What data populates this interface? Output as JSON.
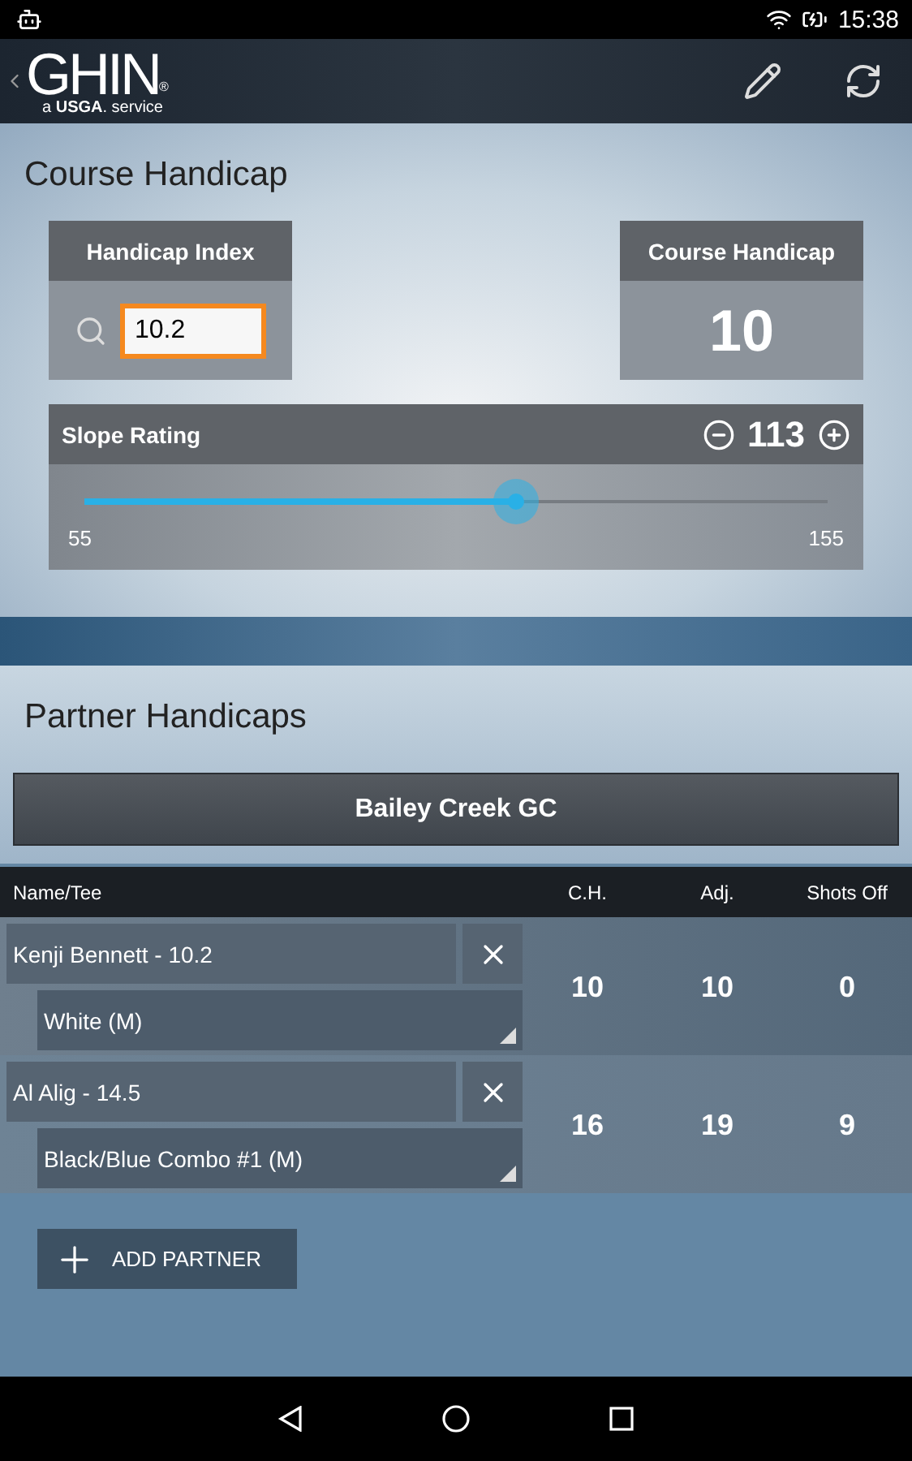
{
  "status_bar": {
    "time": "15:38"
  },
  "app_bar": {
    "logo": "GHIN",
    "logo_mark": "®",
    "tagline": "a **USGA**. service"
  },
  "course_handicap": {
    "title": "Course Handicap",
    "index_label": "Handicap Index",
    "index_value": "10.2",
    "index_focused": true,
    "result_label": "Course Handicap",
    "result_value": "10",
    "slope": {
      "label": "Slope Rating",
      "value": "113",
      "level": 0.58,
      "min": "55",
      "max": "155"
    }
  },
  "partners": {
    "title": "Partner Handicaps",
    "course": "Bailey Creek GC",
    "columns": [
      "Name/Tee",
      "C.H.",
      "Adj.",
      "Shots Off"
    ],
    "rows": [
      {
        "name": "Kenji Bennett - 10.2",
        "tee": "White (M)",
        "ch": "10",
        "adj": "10",
        "shots_off": "0"
      },
      {
        "name": "Al Alig - 14.5",
        "tee": "Black/Blue Combo #1 (M)",
        "ch": "16",
        "adj": "19",
        "shots_off": "9"
      }
    ],
    "add_button": "ADD PARTNER"
  }
}
